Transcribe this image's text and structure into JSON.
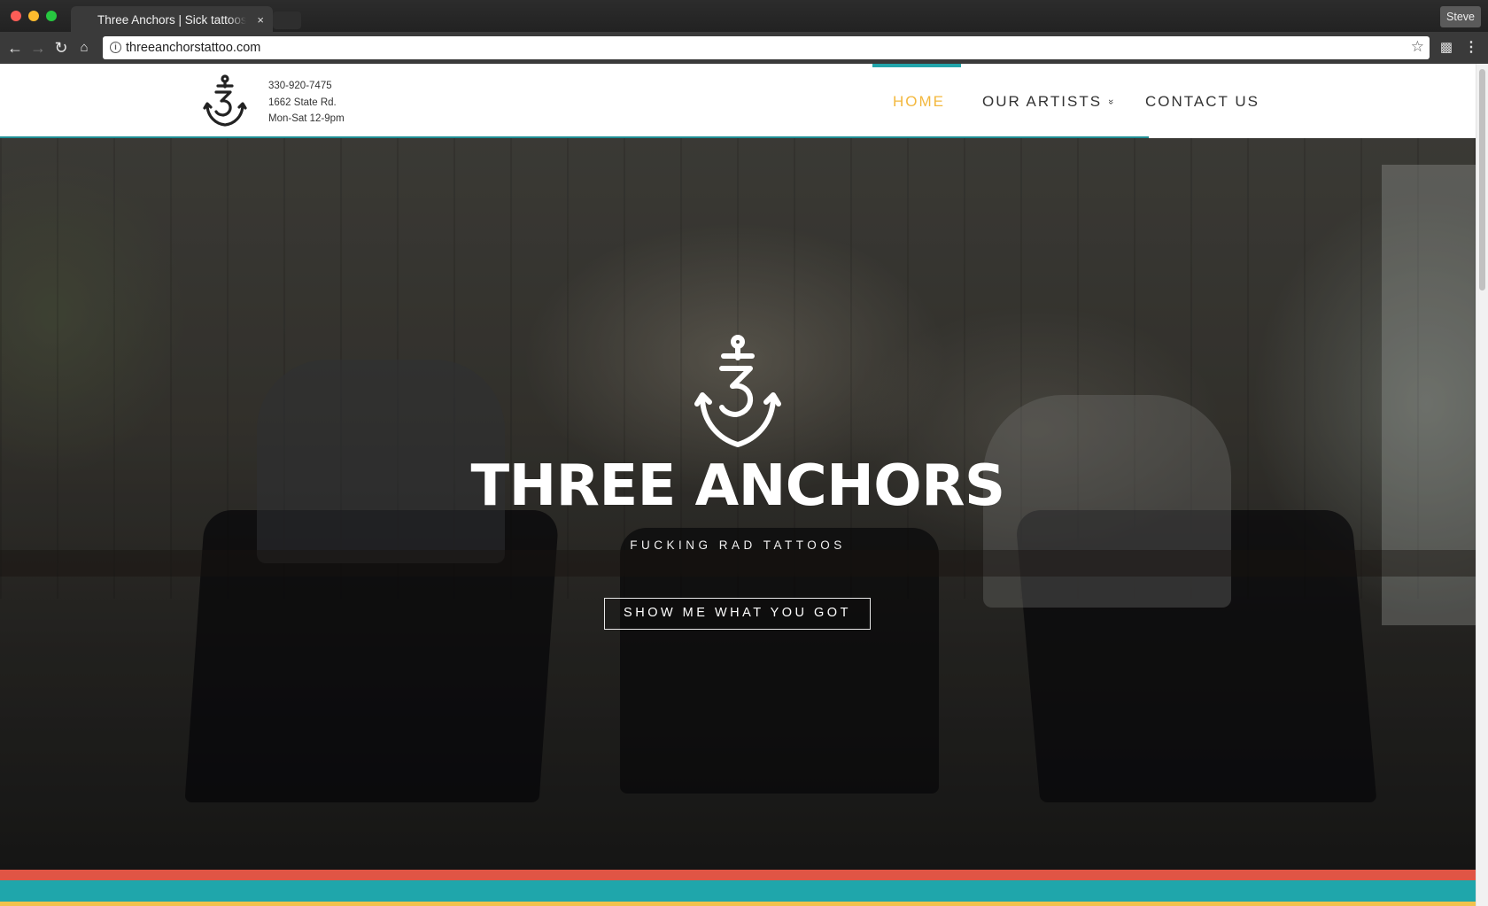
{
  "browser": {
    "tab_title": "Three Anchors | Sick tattoos in",
    "tab_close": "×",
    "profile_name": "Steve",
    "url": "threeanchorstattoo.com"
  },
  "header": {
    "phone": "330-920-7475",
    "address": "1662 State Rd.",
    "hours": "Mon-Sat 12-9pm",
    "nav": {
      "home": "HOME",
      "artists": "OUR ARTISTS",
      "artists_chevron": "»",
      "contact": "CONTACT US"
    }
  },
  "hero": {
    "title": "THREE ANCHORS",
    "tagline": "FUCKING RAD TATTOOS",
    "button": "SHOW ME WHAT YOU GOT"
  },
  "colors": {
    "accent_yellow": "#f3b83e",
    "accent_teal": "#23a5ab",
    "stripe_red": "#e05545",
    "stripe_teal": "#1fa6ab",
    "stripe_yellow": "#f1c24d"
  },
  "icons": {
    "back": "back-arrow-icon",
    "forward": "forward-arrow-icon",
    "reload": "reload-icon",
    "home": "home-icon",
    "info": "info-icon",
    "bookmark": "star-icon",
    "camera": "camera-icon",
    "menu": "kebab-menu-icon",
    "logo": "anchor-logo-icon"
  }
}
